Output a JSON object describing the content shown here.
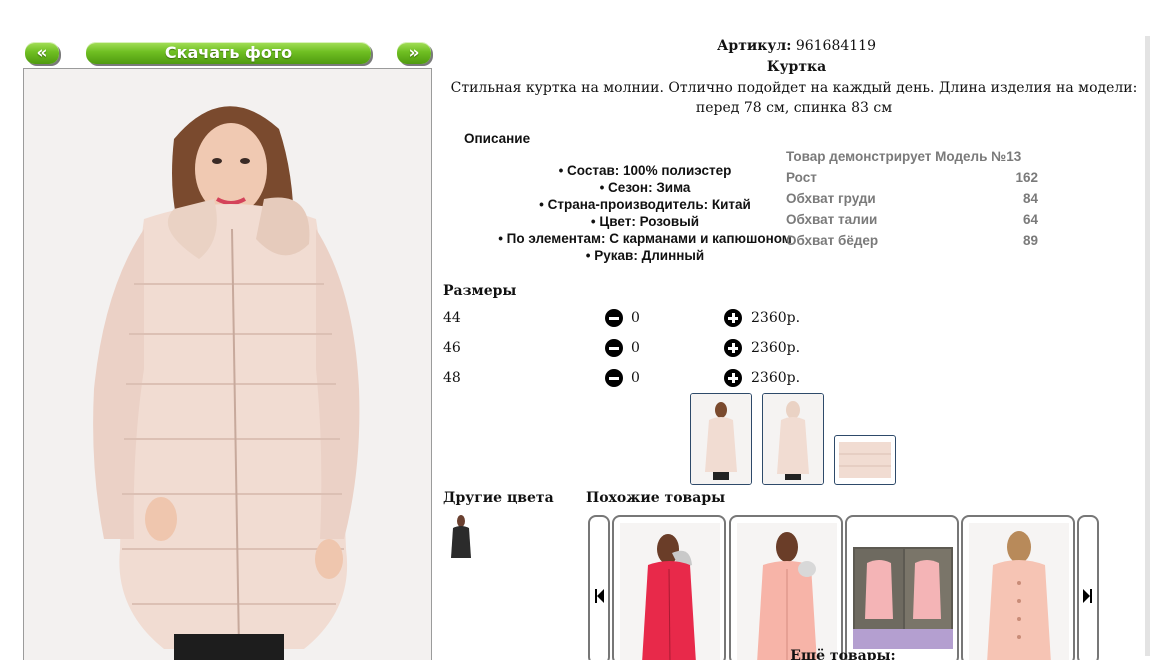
{
  "gallery": {
    "prev_label": "«",
    "download_label": "Скачать фото",
    "next_label": "»"
  },
  "product": {
    "article_label": "Артикул:",
    "article_value": "961684119",
    "title": "Куртка",
    "description": "Стильная куртка на молнии. Отлично подойдет на каждый день. Длина изделия на модели: перед 78 см, спинка 83 см"
  },
  "description_section": {
    "heading": "Описание",
    "items": [
      "• Состав: 100% полиэстер",
      "• Сезон: Зима",
      "• Страна-производитель: Китай",
      "• Цвет: Розовый",
      "• По элементам: С карманами и капюшоном",
      "• Рукав: Длинный"
    ]
  },
  "model": {
    "heading": "Товар демонстрирует Модель №13",
    "rows": [
      {
        "label": "Рост",
        "value": "162"
      },
      {
        "label": "Обхват груди",
        "value": "84"
      },
      {
        "label": "Обхват талии",
        "value": "64"
      },
      {
        "label": "Обхват бёдер",
        "value": "89"
      }
    ]
  },
  "sizes": {
    "heading": "Размеры",
    "rows": [
      {
        "size": "44",
        "qty": "0",
        "price": "2360р."
      },
      {
        "size": "46",
        "qty": "0",
        "price": "2360р."
      },
      {
        "size": "48",
        "qty": "0",
        "price": "2360р."
      }
    ]
  },
  "other_colors": {
    "heading": "Другие цвета"
  },
  "similar": {
    "heading": "Похожие товары"
  },
  "more_label": "Ещё товары:",
  "colors": {
    "button_green": "#5fae18",
    "coat_pink": "#f1dcd2",
    "fur": "#ead2c4",
    "similar_red": "#e8294a",
    "similar_peach": "#f7b4a8"
  }
}
